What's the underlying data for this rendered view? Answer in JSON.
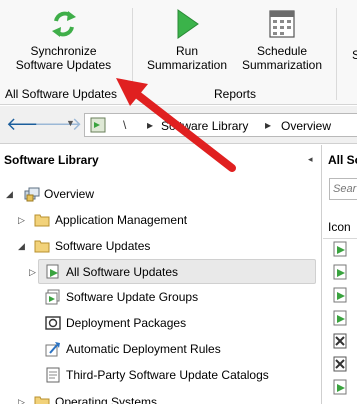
{
  "ribbon": {
    "buttons": [
      {
        "label_line1": "Synchronize",
        "label_line2": "Software Updates",
        "icon": "sync-icon"
      },
      {
        "label_line1": "Run",
        "label_line2": "Summarization",
        "icon": "run-icon"
      },
      {
        "label_line1": "Schedule",
        "label_line2": "Summarization",
        "icon": "schedule-icon"
      },
      {
        "label_line1": "",
        "label_line2": "S",
        "icon": "partial-icon"
      }
    ],
    "groups": [
      "All Software Updates",
      "Reports"
    ]
  },
  "address_bar": {
    "back_icon": "back-arrow-icon",
    "forward_icon": "forward-arrow-icon",
    "dropdown_icon": "chevron-down-icon",
    "root_sep": "\\",
    "sep": "▸",
    "crumbs": [
      "Software Library",
      "Overview"
    ]
  },
  "nav": {
    "title": "Software Library",
    "collapse_glyph": "◂",
    "items": [
      {
        "label": "Overview",
        "expand": "◢"
      },
      {
        "label": "Application Management",
        "expand": "▷"
      },
      {
        "label": "Software Updates",
        "expand": "◢"
      },
      {
        "label": "All Software Updates",
        "expand": "▷"
      },
      {
        "label": "Software Update Groups"
      },
      {
        "label": "Deployment Packages"
      },
      {
        "label": "Automatic Deployment Rules"
      },
      {
        "label": "Third-Party Software Update Catalogs"
      },
      {
        "label": "Operating Systems",
        "expand": "▷"
      }
    ]
  },
  "list": {
    "title": "All So",
    "search_placeholder": "Sear",
    "column_icon": "Icon"
  },
  "colors": {
    "accent_arrow": "#e02020",
    "selection_bg": "#e9e9e9",
    "folder": "#e8c25a"
  }
}
